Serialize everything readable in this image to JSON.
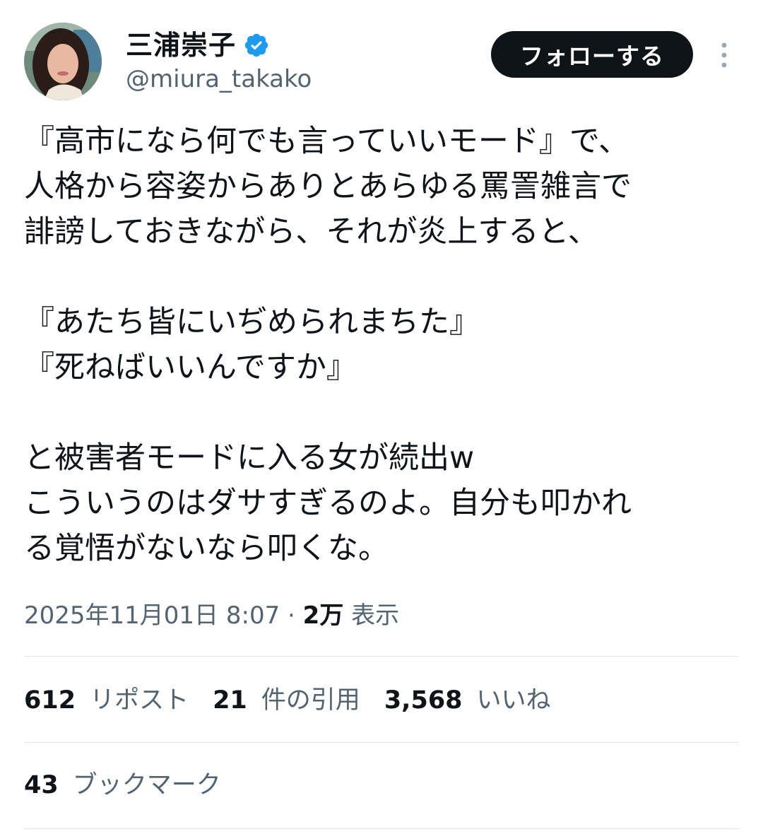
{
  "author": {
    "display_name": "三浦崇子",
    "handle": "@miura_takako",
    "verified_color": "#1d9bf0"
  },
  "follow_button": {
    "label": "フォローする"
  },
  "icons": {
    "avatar": "profile-photo",
    "verified": "verified-badge-icon",
    "more": "more-vertical-icon"
  },
  "tweet": {
    "lines": [
      "『高市になら何でも言っていいモード』で、",
      "人格から容姿からありとあらゆる罵詈雑言で",
      "誹謗しておきながら、それが炎上すると、",
      "",
      "『あたち皆にいぢめられまちた』",
      "『死ねばいいんですか』",
      "",
      "と被害者モードに入る女が続出w",
      "こういうのはダサすぎるのよ。自分も叩かれ",
      "る覚悟がないなら叩くな。"
    ]
  },
  "meta": {
    "timestamp": "2025年11月01日 8:07",
    "separator": " · ",
    "views_count": "2万",
    "views_label": " 表示"
  },
  "stats": {
    "reposts": {
      "count": "612",
      "label": "リポスト"
    },
    "quotes": {
      "count": "21",
      "label": "件の引用"
    },
    "likes": {
      "count": "3,568",
      "label": "いいね"
    },
    "bookmarks": {
      "count": "43",
      "label": "ブックマーク"
    }
  },
  "colors": {
    "text": "#0f1419",
    "secondary": "#536471",
    "divider": "#e1e5e8",
    "button_bg": "#0f1419"
  }
}
